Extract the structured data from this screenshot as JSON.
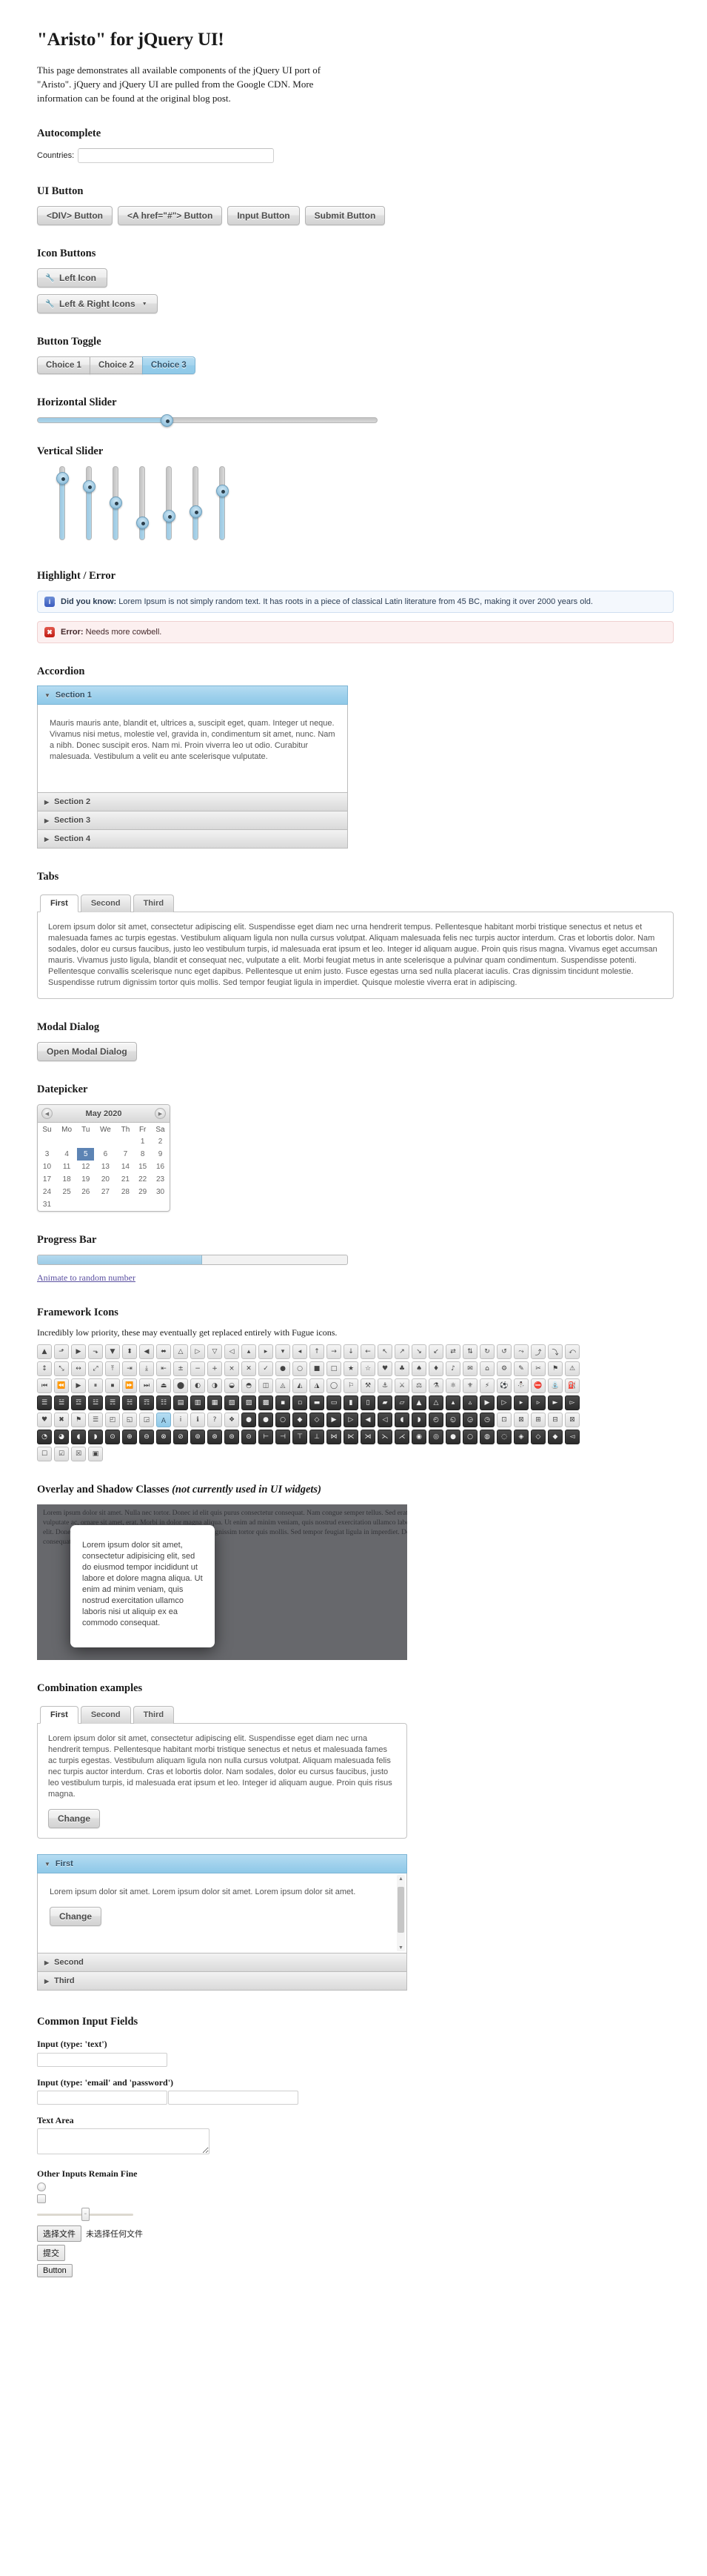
{
  "page": {
    "title": "\"Aristo\" for jQuery UI!",
    "intro": "This page demonstrates all available components of the jQuery UI port of \"Aristo\". jQuery and jQuery UI are pulled from the Google CDN. More information can be found at the original blog post."
  },
  "autocomplete": {
    "heading": "Autocomplete",
    "label": "Countries:",
    "value": "",
    "placeholder": ""
  },
  "ui_button": {
    "heading": "UI Button",
    "buttons": [
      {
        "label": "<DIV> Button"
      },
      {
        "label": "<A href=\"#\"> Button"
      },
      {
        "label": "Input Button"
      },
      {
        "label": "Submit Button"
      }
    ]
  },
  "icon_buttons": {
    "heading": "Icon Buttons",
    "left": {
      "label": "Left Icon",
      "icon": "wrench-icon"
    },
    "leftright": {
      "label": "Left & Right Icons",
      "icon_left": "wrench-icon",
      "icon_right": "chevron-down-icon"
    }
  },
  "button_toggle": {
    "heading": "Button Toggle",
    "choices": [
      {
        "label": "Choice 1",
        "active": false
      },
      {
        "label": "Choice 2",
        "active": false
      },
      {
        "label": "Choice 3",
        "active": true
      }
    ]
  },
  "horizontal_slider": {
    "heading": "Horizontal Slider",
    "value": 38
  },
  "vertical_slider": {
    "heading": "Vertical Slider",
    "values": [
      84,
      72,
      50,
      22,
      32,
      38,
      66
    ]
  },
  "highlight_error": {
    "heading": "Highlight / Error",
    "highlight": {
      "icon": "info-icon",
      "strong": "Did you know:",
      "text": "Lorem Ipsum is not simply random text. It has roots in a piece of classical Latin literature from 45 BC, making it over 2000 years old."
    },
    "error": {
      "icon": "close-icon",
      "strong": "Error:",
      "text": "Needs more cowbell."
    }
  },
  "accordion": {
    "heading": "Accordion",
    "sections": [
      {
        "label": "Section 1",
        "open": true,
        "body": "Mauris mauris ante, blandit et, ultrices a, suscipit eget, quam. Integer ut neque. Vivamus nisi metus, molestie vel, gravida in, condimentum sit amet, nunc. Nam a nibh. Donec suscipit eros. Nam mi. Proin viverra leo ut odio. Curabitur malesuada. Vestibulum a velit eu ante scelerisque vulputate."
      },
      {
        "label": "Section 2",
        "open": false,
        "body": ""
      },
      {
        "label": "Section 3",
        "open": false,
        "body": ""
      },
      {
        "label": "Section 4",
        "open": false,
        "body": ""
      }
    ]
  },
  "tabs": {
    "heading": "Tabs",
    "items": [
      {
        "label": "First",
        "active": true
      },
      {
        "label": "Second",
        "active": false
      },
      {
        "label": "Third",
        "active": false
      }
    ],
    "panel": "Lorem ipsum dolor sit amet, consectetur adipiscing elit. Suspendisse eget diam nec urna hendrerit tempus. Pellentesque habitant morbi tristique senectus et netus et malesuada fames ac turpis egestas. Vestibulum aliquam ligula non nulla cursus volutpat. Aliquam malesuada felis nec turpis auctor interdum. Cras et lobortis dolor. Nam sodales, dolor eu cursus faucibus, justo leo vestibulum turpis, id malesuada erat ipsum et leo. Integer id aliquam augue. Proin quis risus magna. Vivamus eget accumsan mauris. Vivamus justo ligula, blandit et consequat nec, vulputate a elit. Morbi feugiat metus in ante scelerisque a pulvinar quam condimentum. Suspendisse potenti. Pellentesque convallis scelerisque nunc eget dapibus. Pellentesque ut enim justo. Fusce egestas urna sed nulla placerat iaculis. Cras dignissim tincidunt molestie. Suspendisse rutrum dignissim tortor quis mollis. Sed tempor feugiat ligula in imperdiet. Quisque molestie viverra erat in adipiscing."
  },
  "modal": {
    "heading": "Modal Dialog",
    "button": "Open Modal Dialog"
  },
  "datepicker": {
    "heading": "Datepicker",
    "month_year": "May 2020",
    "prev_icon": "chevron-left-icon",
    "next_icon": "chevron-right-icon",
    "daynames": [
      "Su",
      "Mo",
      "Tu",
      "We",
      "Th",
      "Fr",
      "Sa"
    ],
    "weeks": [
      [
        "",
        "",
        "",
        "",
        "",
        "1",
        "2"
      ],
      [
        "3",
        "4",
        "5",
        "6",
        "7",
        "8",
        "9"
      ],
      [
        "10",
        "11",
        "12",
        "13",
        "14",
        "15",
        "16"
      ],
      [
        "17",
        "18",
        "19",
        "20",
        "21",
        "22",
        "23"
      ],
      [
        "24",
        "25",
        "26",
        "27",
        "28",
        "29",
        "30"
      ],
      [
        "31",
        "",
        "",
        "",
        "",
        "",
        ""
      ]
    ],
    "selected": "5"
  },
  "progress": {
    "heading": "Progress Bar",
    "value": 53,
    "link": "Animate to random number"
  },
  "framework_icons": {
    "heading": "Framework Icons",
    "note": "Incredibly low priority, these may eventually get replaced entirely with Fugue icons.",
    "rows": [
      {
        "style": "light",
        "glyphs": [
          "▲",
          "⬏",
          "▶",
          "⬎",
          "▼",
          "⬍",
          "◀",
          "⬌",
          "△",
          "▷",
          "▽",
          "◁",
          "▴",
          "▸",
          "▾",
          "◂",
          "↑",
          "→",
          "↓",
          "←",
          "↖",
          "↗",
          "↘",
          "↙",
          "⇄",
          "⇅",
          "↻",
          "↺",
          "⤳",
          "⤴",
          "⤵",
          "⤺"
        ]
      },
      {
        "style": "light",
        "glyphs": [
          "↕",
          "⤡",
          "↔",
          "⤢",
          "⤒",
          "⇥",
          "⤓",
          "⇤",
          "±",
          "−",
          "+",
          "×",
          "✕",
          "✓",
          "●",
          "○",
          "■",
          "□",
          "★",
          "☆",
          "♥",
          "♣",
          "♠",
          "♦",
          "♪",
          "✉",
          "⌂",
          "⚙",
          "✎",
          "✂",
          "⚑",
          "⚠"
        ]
      },
      {
        "style": "light",
        "glyphs": [
          "⏮",
          "⏪",
          "▶",
          "⏸",
          "⏹",
          "⏩",
          "⏭",
          "⏏",
          "⬤",
          "◐",
          "◑",
          "◒",
          "◓",
          "◫",
          "◬",
          "◭",
          "◮",
          "◯",
          "⚐",
          "⚒",
          "⚓",
          "⚔",
          "⚖",
          "⚗",
          "⚛",
          "⚜",
          "⚡",
          "⚽",
          "⛄",
          "⛔",
          "⛲",
          "⛽"
        ]
      },
      {
        "style": "dark",
        "glyphs": [
          "☰",
          "☱",
          "☲",
          "☳",
          "☴",
          "☵",
          "☶",
          "☷",
          "▤",
          "▥",
          "▦",
          "▧",
          "▨",
          "▩",
          "▪",
          "▫",
          "▬",
          "▭",
          "▮",
          "▯",
          "▰",
          "▱",
          "▲",
          "△",
          "▴",
          "▵",
          "▶",
          "▷",
          "▸",
          "▹",
          "►",
          "▻"
        ]
      },
      {
        "style": "mixed",
        "glyphs": [
          "♥",
          "✖",
          "⚑",
          "☰",
          "◰",
          "◱",
          "◲",
          "Ａ",
          "i",
          "ℹ",
          "?",
          "❖",
          "●",
          "●",
          "○",
          "◆",
          "◇",
          "▶",
          "▷",
          "◀",
          "◁",
          "◖",
          "◗",
          "◴",
          "◵",
          "◶",
          "◷",
          "⊡",
          "⊠",
          "⊞",
          "⊟",
          "⊠"
        ]
      },
      {
        "style": "dark",
        "glyphs": [
          "◔",
          "◕",
          "◖",
          "◗",
          "⊙",
          "⊕",
          "⊖",
          "⊗",
          "⊘",
          "⊚",
          "⊛",
          "⊜",
          "⊝",
          "⊢",
          "⊣",
          "⊤",
          "⊥",
          "⋈",
          "⋉",
          "⋊",
          "⋋",
          "⋌",
          "◉",
          "◎",
          "●",
          "○",
          "◍",
          "◌",
          "◈",
          "◇",
          "◆",
          "◅"
        ]
      },
      {
        "style": "light",
        "glyphs": [
          "☐",
          "☑",
          "☒",
          "▣"
        ]
      }
    ]
  },
  "overlay": {
    "heading_main": "Overlay and Shadow Classes ",
    "heading_ital": "(not currently used in UI widgets)",
    "bgtext": "Lorem ipsum dolor sit amet. Nulla nec tortor. Donec id elit quis purus consectetur consequat.\nNam congue semper tellus. Sed erat dolor, dapibus sit amet, venenatis ornare, ultrices ut, nisi. Aliquam ante. Suspendisse scelerisque dui nec velit. Duis augue augue, gravida euismod, vulputate ac, ornare sit amet, erat. Morbi in dolor magna aliqua. Ut enim ad minim veniam, quis nostrud exercitation ullamco laboris nisi ut aliquip ex ea commodo consequat.\nNulla facilisi. Nullam sit amet dolor. Cras dignissim tincidunt molestie. Suspendisse rutrum. Nam molestie elit. Donec libero risus, commodo vitae, pharetra curabitur dignissim tortor quis mollis. Sed tempor feugiat ligula in imperdiet. Donec id elit quis purus consectetur consequat.\nDuis fugiat dapibus lacus. Lorem ipsum dolor sit amet. Nulla nec tortor. Donec id elit quis purus consectetur consequat.",
    "card": "Lorem ipsum dolor sit amet, consectetur adipisicing elit, sed do eiusmod tempor incididunt ut labore et dolore magna aliqua. Ut enim ad minim veniam, quis nostrud exercitation ullamco laboris nisi ut aliquip ex ea commodo consequat."
  },
  "combination": {
    "heading": "Combination examples",
    "tabs": [
      {
        "label": "First",
        "active": true
      },
      {
        "label": "Second",
        "active": false
      },
      {
        "label": "Third",
        "active": false
      }
    ],
    "tab_panel": "Lorem ipsum dolor sit amet, consectetur adipiscing elit. Suspendisse eget diam nec urna hendrerit tempus. Pellentesque habitant morbi tristique senectus et netus et malesuada fames ac turpis egestas. Vestibulum aliquam ligula non nulla cursus volutpat. Aliquam malesuada felis nec turpis auctor interdum. Cras et lobortis dolor. Nam sodales, dolor eu cursus faucibus, justo leo vestibulum turpis, id malesuada erat ipsum et leo. Integer id aliquam augue. Proin quis risus magna.",
    "tab_button": "Change",
    "accordion": [
      {
        "label": "First",
        "open": true,
        "body": "Lorem ipsum dolor sit amet. Lorem ipsum dolor sit amet. Lorem ipsum dolor sit amet.",
        "button": "Change"
      },
      {
        "label": "Second",
        "open": false,
        "body": "",
        "button": ""
      },
      {
        "label": "Third",
        "open": false,
        "body": "",
        "button": ""
      }
    ]
  },
  "common_inputs": {
    "heading": "Common Input Fields",
    "text_label": "Input (type: 'text')",
    "text_value": "",
    "emailpw_label": "Input (type: 'email' and 'password')",
    "email_value": "",
    "password_value": "",
    "textarea_label": "Text Area",
    "textarea_value": "",
    "other_label": "Other Inputs Remain Fine",
    "file_button": "选择文件",
    "file_status": "未选择任何文件",
    "submit_button": "提交",
    "plain_button": "Button"
  }
}
